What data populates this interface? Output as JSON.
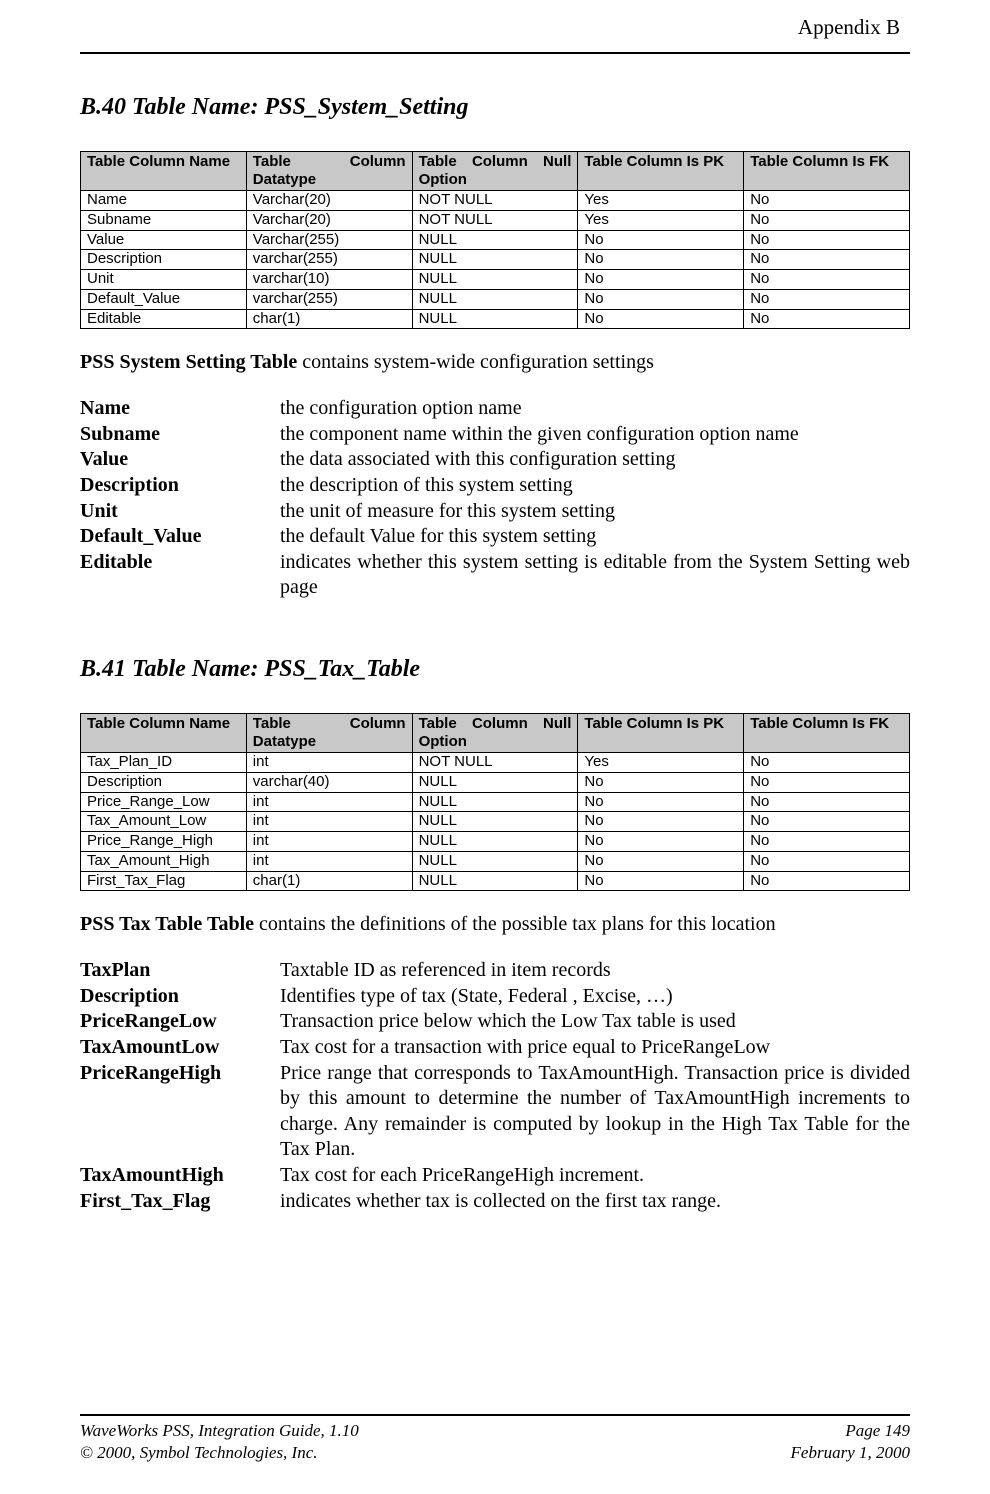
{
  "header": {
    "appendix": "Appendix B"
  },
  "section_b40": {
    "heading": "B.40  Table Name: PSS_System_Setting",
    "table": {
      "headers": {
        "col1": "Table Column Name",
        "col2a": "Table",
        "col2b": "Column",
        "col2c": "Datatype",
        "col3a": "Table",
        "col3b": "Column",
        "col3c": "Null",
        "col3d": "Option",
        "col4": "Table Column Is PK",
        "col5": "Table Column Is FK"
      },
      "rows": [
        {
          "name": "Name",
          "type": "Varchar(20)",
          "null": "NOT NULL",
          "pk": "Yes",
          "fk": "No"
        },
        {
          "name": "Subname",
          "type": "Varchar(20)",
          "null": "NOT NULL",
          "pk": "Yes",
          "fk": "No"
        },
        {
          "name": "Value",
          "type": "Varchar(255)",
          "null": "NULL",
          "pk": "No",
          "fk": "No"
        },
        {
          "name": "Description",
          "type": "varchar(255)",
          "null": "NULL",
          "pk": "No",
          "fk": "No"
        },
        {
          "name": "Unit",
          "type": "varchar(10)",
          "null": "NULL",
          "pk": "No",
          "fk": "No"
        },
        {
          "name": "Default_Value",
          "type": "varchar(255)",
          "null": "NULL",
          "pk": "No",
          "fk": "No"
        },
        {
          "name": "Editable",
          "type": "char(1)",
          "null": "NULL",
          "pk": "No",
          "fk": "No"
        }
      ]
    },
    "summary_bold": "PSS System Setting Table",
    "summary_text": " contains system-wide configuration settings",
    "defs": [
      {
        "term": "Name",
        "desc": "the configuration option name"
      },
      {
        "term": "Subname",
        "desc": "the component name within the given configuration option name"
      },
      {
        "term": "Value",
        "desc": "the data associated with this configuration setting"
      },
      {
        "term": "Description",
        "desc": "the description of this system setting"
      },
      {
        "term": "Unit",
        "desc": "the unit of measure for this system setting"
      },
      {
        "term": "Default_Value",
        "desc": "the default Value for this system setting"
      },
      {
        "term": "Editable",
        "desc": "indicates whether this system setting is editable from the System Setting web page"
      }
    ]
  },
  "section_b41": {
    "heading": "B.41  Table Name: PSS_Tax_Table",
    "table": {
      "headers": {
        "col1": "Table Column Name",
        "col2a": "Table",
        "col2b": "Column",
        "col2c": "Datatype",
        "col3a": "Table",
        "col3b": "Column",
        "col3c": "Null",
        "col3d": "Option",
        "col4": "Table Column Is PK",
        "col5": "Table Column Is FK"
      },
      "rows": [
        {
          "name": "Tax_Plan_ID",
          "type": "int",
          "null": "NOT NULL",
          "pk": "Yes",
          "fk": "No"
        },
        {
          "name": "Description",
          "type": "varchar(40)",
          "null": "NULL",
          "pk": "No",
          "fk": "No"
        },
        {
          "name": "Price_Range_Low",
          "type": "int",
          "null": "NULL",
          "pk": "No",
          "fk": "No"
        },
        {
          "name": "Tax_Amount_Low",
          "type": "int",
          "null": "NULL",
          "pk": "No",
          "fk": "No"
        },
        {
          "name": "Price_Range_High",
          "type": "int",
          "null": "NULL",
          "pk": "No",
          "fk": "No"
        },
        {
          "name": "Tax_Amount_High",
          "type": "int",
          "null": "NULL",
          "pk": "No",
          "fk": "No"
        },
        {
          "name": "First_Tax_Flag",
          "type": "char(1)",
          "null": "NULL",
          "pk": "No",
          "fk": "No"
        }
      ]
    },
    "summary_bold": "PSS Tax Table Table",
    "summary_text": " contains the definitions of the possible tax plans for this location",
    "defs": [
      {
        "term": "TaxPlan",
        "desc": "Taxtable ID as referenced in item records"
      },
      {
        "term": "Description",
        "desc": "Identifies type of tax (State, Federal , Excise, …)"
      },
      {
        "term": "PriceRangeLow",
        "desc": "Transaction price below which the Low Tax table is used"
      },
      {
        "term": "TaxAmountLow",
        "desc": "Tax cost for a transaction with price equal to PriceRangeLow"
      },
      {
        "term": "PriceRangeHigh",
        "desc": "Price range that corresponds to TaxAmountHigh. Transaction price is divided by this amount to determine the number of TaxAmountHigh increments to charge. Any remainder is computed by lookup in the High Tax Table for the Tax Plan."
      },
      {
        "term": "TaxAmountHigh",
        "desc": "Tax cost for each PriceRangeHigh increment."
      },
      {
        "term": "First_Tax_Flag",
        "desc": "indicates whether tax is collected on the first tax range."
      }
    ]
  },
  "footer": {
    "left1": "WaveWorks PSS, Integration Guide, 1.10",
    "right1": "Page 149",
    "left2": "© 2000, Symbol Technologies, Inc.",
    "right2": "February 1, 2000"
  }
}
